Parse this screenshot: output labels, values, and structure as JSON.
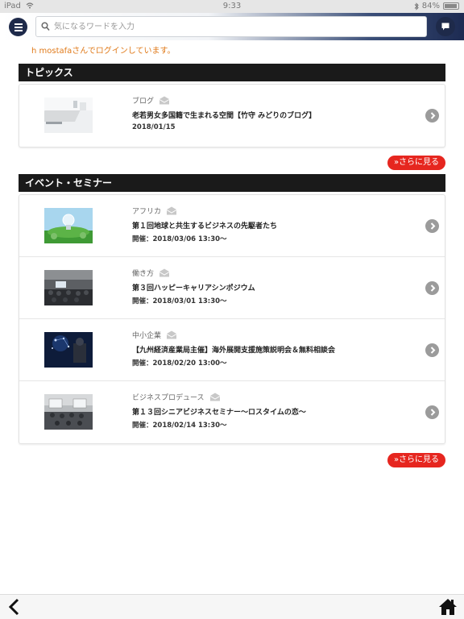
{
  "status": {
    "device": "iPad",
    "time": "9:33",
    "battery": "84%",
    "battery_level": 0.84
  },
  "search": {
    "placeholder": "気になるワードを入力",
    "value": ""
  },
  "login_message": "h mostafaさんでログインしています。",
  "topics": {
    "heading": "トピックス",
    "items": [
      {
        "category": "ブログ",
        "title": "老若男女多国籍で生まれる空間【竹守 みどりのブログ】",
        "date": "2018/01/15"
      }
    ],
    "more": "»さらに見る"
  },
  "events": {
    "heading": "イベント・セミナー",
    "items": [
      {
        "category": "アフリカ",
        "title": "第１回地球と共生するビジネスの先駆者たち",
        "date": "開催：2018/03/06 13:30〜"
      },
      {
        "category": "働き方",
        "title": "第３回ハッピーキャリアシンポジウム",
        "date": "開催：2018/03/01 13:30〜"
      },
      {
        "category": "中小企業",
        "title": "【九州経済産業局主催】海外展開支援施策説明会＆無料相談会",
        "date": "開催：2018/02/20 13:00〜"
      },
      {
        "category": "ビジネスプロデュース",
        "title": "第１３回シニアビジネスセミナー〜ロスタイムの恋〜",
        "date": "開催：2018/02/14 13:30〜"
      }
    ],
    "more": "»さらに見る"
  }
}
